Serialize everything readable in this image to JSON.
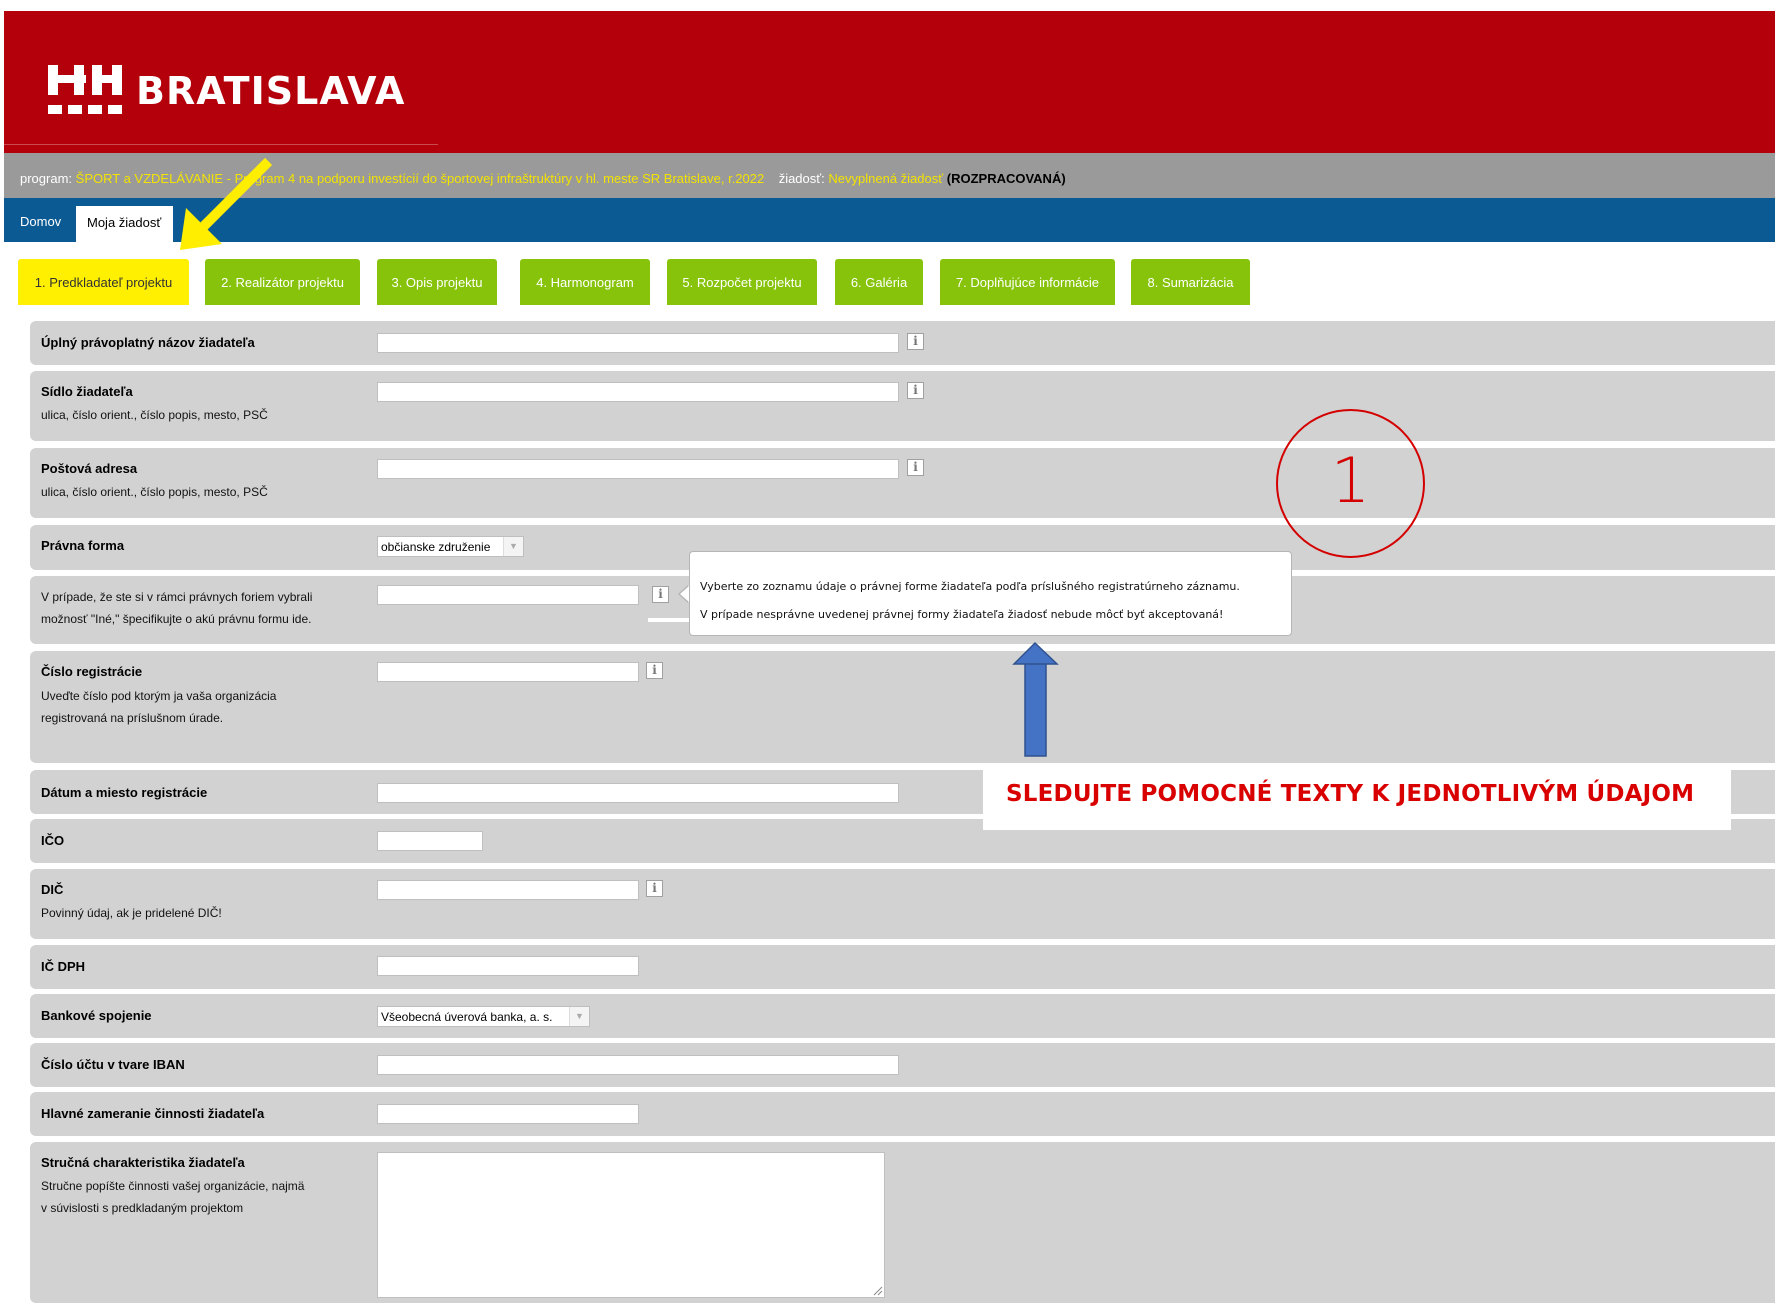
{
  "header": {
    "logo_text": "BRATISLAVA"
  },
  "program_bar": {
    "program_label": "program:",
    "program_name": "ŠPORT a VZDELÁVANIE - Program 4 na podporu investícií do športovej infraštruktúry v hl. meste SR Bratislave, r.2022",
    "request_label": "žiadosť:",
    "request_name": "Nevyplnená žiadosť",
    "request_status": "(ROZPRACOVANÁ)"
  },
  "nav": {
    "home": "Domov",
    "my_request": "Moja žiadosť"
  },
  "tabs": [
    {
      "label": "1. Predkladateľ projektu"
    },
    {
      "label": "2. Realizátor projektu"
    },
    {
      "label": "3. Opis projektu"
    },
    {
      "label": "4. Harmonogram"
    },
    {
      "label": "5. Rozpočet projektu"
    },
    {
      "label": "6. Galéria"
    },
    {
      "label": "7. Doplňujúce informácie"
    },
    {
      "label": "8. Sumarizácia"
    }
  ],
  "form": {
    "full_name": {
      "label": "Úplný právoplatný názov žiadateľa",
      "value": ""
    },
    "seat": {
      "label": "Sídlo žiadateľa",
      "hint": "ulica, číslo orient., číslo popis, mesto, PSČ",
      "value": ""
    },
    "postal": {
      "label": "Poštová adresa",
      "hint": "ulica, číslo orient., číslo popis, mesto, PSČ",
      "value": ""
    },
    "legal_form": {
      "label": "Právna forma",
      "value": "občianske združenie"
    },
    "other_form": {
      "label_line1": "V prípade, že ste si v rámci právnych foriem vybrali",
      "label_line2": "možnosť \"Iné,\" špecifikujte o akú právnu formu ide.",
      "value": ""
    },
    "reg_number": {
      "label": "Číslo registrácie",
      "hint_line1": "Uveďte číslo pod ktorým ja vaša organizácia",
      "hint_line2": "registrovaná na príslušnom úrade.",
      "value": ""
    },
    "reg_date": {
      "label": "Dátum a miesto registrácie",
      "value": ""
    },
    "ico": {
      "label": "IČO",
      "value": ""
    },
    "dic": {
      "label": "DIČ",
      "hint": "Povinný údaj, ak je pridelené DIČ!",
      "value": ""
    },
    "ic_dph": {
      "label": "IČ DPH",
      "value": ""
    },
    "bank": {
      "label": "Bankové spojenie",
      "value": "Všeobecná úverová banka, a. s."
    },
    "iban": {
      "label": "Číslo účtu v tvare IBAN",
      "value": ""
    },
    "focus": {
      "label": "Hlavné zameranie činnosti žiadateľa",
      "value": ""
    },
    "summary": {
      "label": "Stručná charakteristika žiadateľa",
      "hint_line1": "Stručne popíšte činnosti vašej organizácie, najmä",
      "hint_line2": "v súvislosti s predkladaným projektom",
      "value": ""
    }
  },
  "tooltip": {
    "line1": "Vyberte zo zoznamu údaje o právnej forme žiadateľa podľa príslušného registratúrneho záznamu.",
    "line2": "V prípade nesprávne uvedenej právnej formy žiadateľa žiadosť nebude môcť byť akceptovaná!"
  },
  "info_glyph": "i",
  "annotation": {
    "callout": "SLEDUJTE POMOCNÉ TEXTY K JEDNOTLIVÝM ÚDAJOM",
    "step_number": "1"
  },
  "colors": {
    "header_red": "#b3000b",
    "nav_blue": "#0c5a93",
    "tab_green": "#86c30a",
    "tab_active_yellow": "#ffef00",
    "row_gray": "#d2d2d2",
    "callout_red": "#d90000",
    "arrow_yellow": "#ffee00",
    "arrow_blue": "#4472c4"
  },
  "icons": [
    "bratislava-logo-icon",
    "info-icon",
    "dropdown-arrow-icon",
    "resize-grip-icon",
    "yellow-arrow-icon",
    "blue-arrow-icon"
  ]
}
